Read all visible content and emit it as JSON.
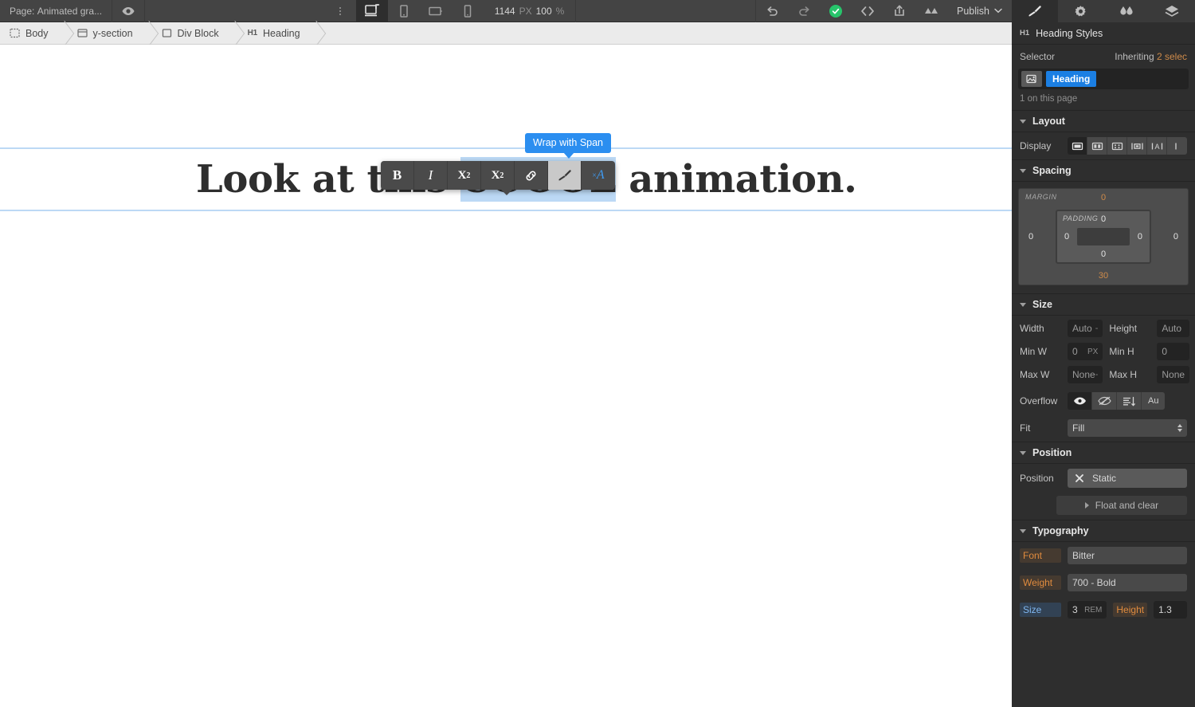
{
  "topbar": {
    "page_prefix": "Page:",
    "page_name": "Animated gra...",
    "preview_icon": "eye-icon",
    "more_icon": "kebab-menu-icon",
    "breakpoints": [
      {
        "name": "desktop",
        "icon": "desktop-icon",
        "active": true
      },
      {
        "name": "tablet",
        "icon": "tablet-icon",
        "active": false
      },
      {
        "name": "mobile-landscape",
        "icon": "mobile-landscape-icon",
        "active": false
      },
      {
        "name": "mobile-portrait",
        "icon": "mobile-portrait-icon",
        "active": false
      }
    ],
    "viewport_width": "1144",
    "viewport_unit": "PX",
    "zoom_value": "100",
    "zoom_unit": "%",
    "undo_icon": "undo-icon",
    "redo_icon": "redo-icon",
    "save_status_icon": "checkmark-icon",
    "save_status_color": "#27c46b",
    "code_icon": "code-brackets-icon",
    "export_icon": "export-icon",
    "webflow_icon": "webflow-logo-icon",
    "publish_label": "Publish",
    "publish_caret": "chevron-down-icon"
  },
  "breadcrumb": [
    {
      "label": "Body",
      "icon": "body-icon"
    },
    {
      "label": "y-section",
      "icon": "section-icon"
    },
    {
      "label": "Div Block",
      "icon": "div-block-icon"
    },
    {
      "label": "Heading",
      "icon": "h1-tag-icon",
      "tag": "H1"
    }
  ],
  "canvas": {
    "heading_before": "Look at this ",
    "heading_selected": "COOOL",
    "heading_after": " animation.",
    "selection_color": "#bcd9f5",
    "guide_color": "#bcd9f5"
  },
  "text_toolbar": {
    "tooltip": "Wrap with Span",
    "tooltip_color": "#2b8ef0",
    "buttons": [
      {
        "name": "bold-button",
        "label": "B",
        "state": "normal"
      },
      {
        "name": "italic-button",
        "label": "I",
        "state": "normal"
      },
      {
        "name": "superscript-button",
        "label": "X2",
        "state": "normal"
      },
      {
        "name": "subscript-button",
        "label": "X2",
        "state": "normal"
      },
      {
        "name": "link-button",
        "label": "link-icon",
        "state": "normal"
      },
      {
        "name": "wrap-with-span-button",
        "label": "paintbrush-icon",
        "state": "hover"
      },
      {
        "name": "clear-formatting-button",
        "label": "xA",
        "state": "accent"
      }
    ]
  },
  "right_panel": {
    "tabs": [
      {
        "name": "style-tab",
        "icon": "paintbrush-icon",
        "active": true
      },
      {
        "name": "settings-tab",
        "icon": "gear-icon",
        "active": false
      },
      {
        "name": "interactions-tab",
        "icon": "droplets-icon",
        "active": false
      },
      {
        "name": "assets-tab",
        "icon": "layers-icon",
        "active": false
      }
    ],
    "title_tag": "H1",
    "title": "Heading Styles",
    "selector": {
      "label": "Selector",
      "inheriting_prefix": "Inheriting",
      "inheriting_value": "2 selec",
      "icon": "selector-image-icon",
      "tag": "Heading",
      "tag_color": "#1b7fe3",
      "note": "1 on this page"
    },
    "layout": {
      "title": "Layout",
      "display_label": "Display",
      "display_options": [
        {
          "name": "display-block",
          "icon": "block-icon",
          "active": true
        },
        {
          "name": "display-flex",
          "icon": "flex-icon",
          "active": false
        },
        {
          "name": "display-grid",
          "icon": "grid-icon",
          "active": false
        },
        {
          "name": "display-inline-block",
          "icon": "inline-block-icon",
          "active": false
        },
        {
          "name": "display-inline",
          "icon": "inline-icon",
          "active": false
        },
        {
          "name": "display-none",
          "icon": "none-icon",
          "active": false
        }
      ]
    },
    "spacing": {
      "title": "Spacing",
      "margin_label": "MARGIN",
      "padding_label": "PADDING",
      "margin": {
        "top": "0",
        "right": "0",
        "bottom": "30",
        "left": "0"
      },
      "padding": {
        "top": "0",
        "right": "0",
        "bottom": "0",
        "left": "0"
      },
      "highlight_color": "#cf8b4a"
    },
    "size": {
      "title": "Size",
      "width_label": "Width",
      "width_value": "Auto",
      "height_label": "Height",
      "height_value": "Auto",
      "minw_label": "Min W",
      "minw_value": "0",
      "minw_unit": "PX",
      "minh_label": "Min H",
      "minh_value": "0",
      "maxw_label": "Max W",
      "maxw_value": "None",
      "maxh_label": "Max H",
      "maxh_value": "None",
      "overflow_label": "Overflow",
      "overflow_options": [
        {
          "name": "overflow-visible",
          "icon": "eye-icon",
          "active": true
        },
        {
          "name": "overflow-hidden",
          "icon": "eye-slash-icon",
          "active": false
        },
        {
          "name": "overflow-scroll",
          "icon": "scroll-icon",
          "active": false
        },
        {
          "name": "overflow-auto",
          "icon": "auto-label",
          "label": "Au",
          "active": false
        }
      ],
      "fit_label": "Fit",
      "fit_value": "Fill"
    },
    "position": {
      "title": "Position",
      "label": "Position",
      "value": "Static",
      "clear_icon": "x-icon",
      "float_label": "Float and clear"
    },
    "typography": {
      "title": "Typography",
      "font_label": "Font",
      "font_value": "Bitter",
      "weight_label": "Weight",
      "weight_value": "700 - Bold",
      "size_label": "Size",
      "size_value": "3",
      "size_unit": "REM",
      "height_label": "Height",
      "height_value": "1.3"
    }
  }
}
